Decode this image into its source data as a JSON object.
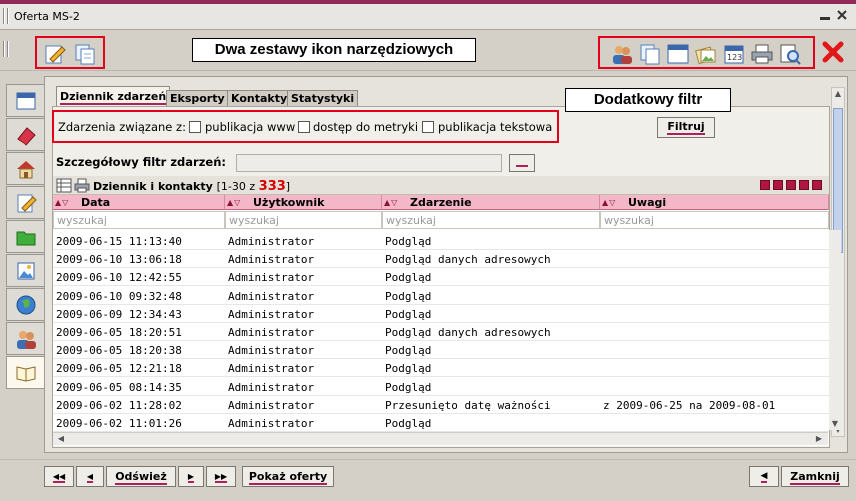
{
  "window": {
    "title": "Oferta MS-2",
    "minimize_icon": "minimize-icon",
    "close_icon": "close-icon"
  },
  "callouts": {
    "toolbars": "Dwa zestawy ikon narzędziowych",
    "filter": "Dodatkowy filtr"
  },
  "colors": {
    "accent": "#8e2a55",
    "highlight_border": "#e2001a",
    "header_pink": "#f3b7c8",
    "count_red": "#d40000"
  },
  "tabs": [
    {
      "label": "Dziennik zdarzeń"
    },
    {
      "label": "Eksporty"
    },
    {
      "label": "Kontakty"
    },
    {
      "label": "Statystyki"
    }
  ],
  "filter": {
    "label": "Zdarzenia związane z:",
    "options": [
      "publikacja www",
      "dostęp do metryki",
      "publikacja tekstowa"
    ],
    "button": "Filtruj"
  },
  "detail_filter": {
    "label": "Szczegółowy filtr zdarzeń:",
    "value": ""
  },
  "grid": {
    "title": "Dziennik i kontakty",
    "range_prefix": "[1-30 z ",
    "total": "333",
    "range_suffix": "]",
    "columns": [
      "Data",
      "Użytkownik",
      "Zdarzenie",
      "Uwagi"
    ],
    "search_placeholder": "wyszukaj",
    "rows": [
      [
        "2009-06-15 11:13:40",
        "Administrator",
        "Podgląd",
        ""
      ],
      [
        "2009-06-10 13:06:18",
        "Administrator",
        "Podgląd danych adresowych",
        ""
      ],
      [
        "2009-06-10 12:42:55",
        "Administrator",
        "Podgląd",
        ""
      ],
      [
        "2009-06-10 09:32:48",
        "Administrator",
        "Podgląd",
        ""
      ],
      [
        "2009-06-09 12:34:43",
        "Administrator",
        "Podgląd",
        ""
      ],
      [
        "2009-06-05 18:20:51",
        "Administrator",
        "Podgląd danych adresowych",
        ""
      ],
      [
        "2009-06-05 18:20:38",
        "Administrator",
        "Podgląd",
        ""
      ],
      [
        "2009-06-05 12:21:18",
        "Administrator",
        "Podgląd",
        ""
      ],
      [
        "2009-06-05 08:14:35",
        "Administrator",
        "Podgląd",
        ""
      ],
      [
        "2009-06-02 11:28:02",
        "Administrator",
        "Przesunięto datę ważności",
        "z 2009-06-25 na 2009-08-01"
      ],
      [
        "2009-06-02 11:01:26",
        "Administrator",
        "Podgląd",
        ""
      ]
    ]
  },
  "bottom": {
    "first": "◀◀",
    "prev": "◀",
    "refresh": "Odśwież",
    "next": "▶",
    "last": "▶▶",
    "show_offers": "Pokaż oferty",
    "close_arrow": "◀",
    "close": "Zamknij"
  },
  "side_icons": [
    "calendar-icon",
    "eraser-icon",
    "home-icon",
    "edit-note-icon",
    "folder-icon",
    "image-icon",
    "globe-icon",
    "users-icon",
    "book-icon"
  ],
  "toolbar_left_icons": [
    "edit-icon",
    "copy-icon"
  ],
  "toolbar_right_icons": [
    "users-icon",
    "copy-icon",
    "window-icon",
    "photo-icon",
    "calendar-icon",
    "printer-icon",
    "print-preview-icon",
    "delete-icon"
  ]
}
